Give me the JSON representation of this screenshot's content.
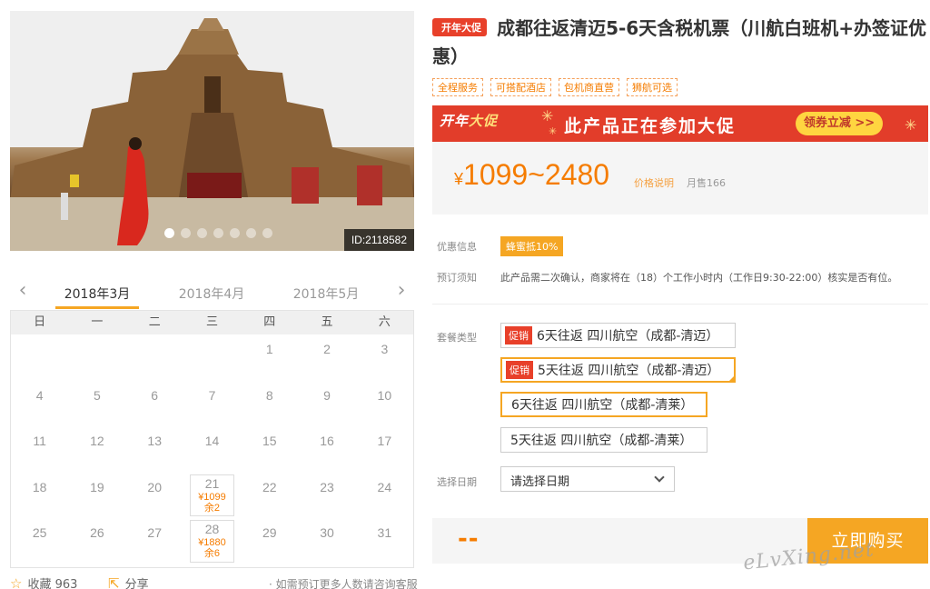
{
  "hero": {
    "id_label": "ID:2118582",
    "dot_count": 7,
    "active_dot": 0
  },
  "calendar": {
    "months": [
      "2018年3月",
      "2018年4月",
      "2018年5月"
    ],
    "active_month": 0,
    "weekdays": [
      "日",
      "一",
      "二",
      "三",
      "四",
      "五",
      "六"
    ],
    "leading_blanks": 4,
    "days_in_month": 31,
    "available": {
      "21": {
        "price": "¥1099",
        "remain": "余2"
      },
      "28": {
        "price": "¥1880",
        "remain": "余6"
      }
    }
  },
  "bottom": {
    "favorite": "收藏 963",
    "share": "分享",
    "note": "如需预订更多人数请咨询客服"
  },
  "product": {
    "badge": "开年大促",
    "title": "成都往返清迈5-6天含税机票（川航白班机+办签证优惠）",
    "tags": [
      "全程服务",
      "可搭配酒店",
      "包机商直营",
      "狮航可选"
    ]
  },
  "banner": {
    "left_text_a": "开年",
    "left_text_b": "大促",
    "main_text": "此产品正在参加大促",
    "button": "领券立减 >>"
  },
  "price": {
    "currency": "¥",
    "range": "1099~2480",
    "explain": "价格说明",
    "sold": "月售166"
  },
  "info": {
    "discount_label": "优惠信息",
    "discount_badge": "蜂蜜抵10%",
    "notice_label": "预订须知",
    "notice_text": "此产品需二次确认，商家将在（18）个工作小时内（工作日9:30-22:00）核实是否有位。",
    "package_label": "套餐类型",
    "date_label": "选择日期"
  },
  "packages": [
    {
      "promo": "促销",
      "label": "6天往返 四川航空（成都-清迈）",
      "state": "normal"
    },
    {
      "promo": "促销",
      "label": "5天往返 四川航空（成都-清迈）",
      "state": "selected"
    },
    {
      "promo": "",
      "label": "6天往返 四川航空（成都-清莱）",
      "state": "highlight"
    },
    {
      "promo": "",
      "label": "5天往返 四川航空（成都-清莱）",
      "state": "normal"
    }
  ],
  "date_select": {
    "placeholder": "请选择日期"
  },
  "buy": {
    "total": "--",
    "button": "立即购买"
  },
  "watermark": "eLvXing.net",
  "colors": {
    "accent": "#f5a623",
    "price": "#f57c00",
    "promo_red": "#e8402a"
  }
}
